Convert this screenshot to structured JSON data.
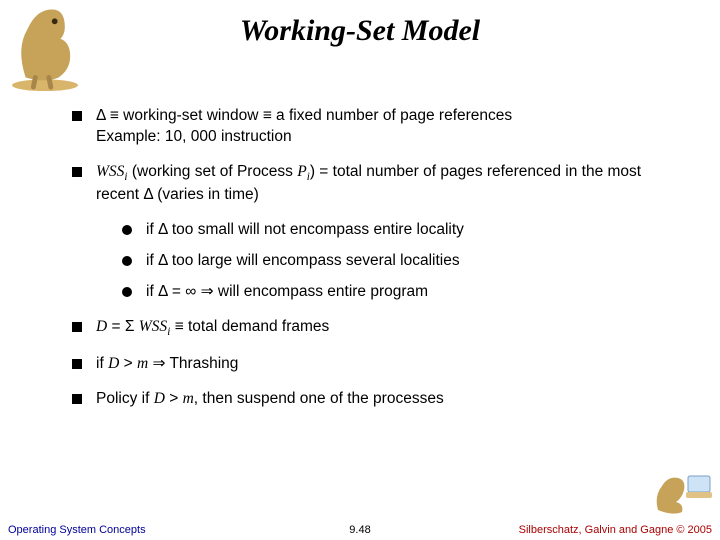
{
  "title": "Working-Set Model",
  "bullets": {
    "b0": {
      "line1": "Δ ≡ working-set window ≡ a fixed number of page references",
      "line2": "Example:  10, 000 instruction"
    },
    "b1": {
      "part1": " (working set of Process ",
      "part2": ") = ",
      "part3": "total number of pages referenced in the most recent Δ (varies in time)",
      "sub": [
        "if Δ too small will not encompass entire locality",
        "if Δ too large will encompass several localities",
        "if Δ = ∞ ⇒ will encompass entire program"
      ]
    },
    "b2": {
      "tail": " ≡ total demand frames"
    },
    "b3": {
      "pre": "if ",
      "post": " ⇒ Thrashing"
    },
    "b4": {
      "pre": "Policy if ",
      "post": ", then suspend one of the processes"
    }
  },
  "footer": {
    "left": "Operating System Concepts",
    "center": "9.48",
    "right": "Silberschatz, Galvin and Gagne © 2005"
  }
}
